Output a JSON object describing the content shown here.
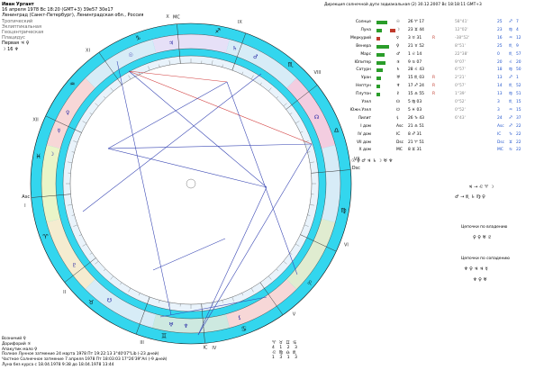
{
  "header": {
    "name": "Иван Ургант",
    "datetime": "16 апреля 1978  Вс  18:20 (GMT+3) 39е57  30е17",
    "place": "Ленинград (Санкт-Петербург), Ленинградская обл., Россия",
    "systems": [
      "Тропический",
      "Эклиптикальная",
      "Геоцентрическая",
      "Плацидус"
    ],
    "rank_label": "Первая",
    "rank_symbols": "♃  ♀",
    "rank_line2": "☽  16  ♆"
  },
  "progression_title": "Дирекция солнечной дуги зодиакальная (2) 30.12.2007  Вс 18:18:11 GMT+3",
  "table_headers": [
    "",
    "",
    " ",
    "R",
    "E",
    "D",
    "F",
    "Ω",
    "V"
  ],
  "planets": [
    {
      "name": "Солнце",
      "glyph": "☉",
      "pos": "26 ♈ 17",
      "retro": "",
      "dign": "",
      "lat": "58°41'",
      "bar": "#2a9d2a",
      "bar_w": 24,
      "col2": "",
      "house": "25",
      "house_sign": "♐",
      "hn": "7"
    },
    {
      "name": "Луна",
      "glyph": "☽",
      "pos": "23 ♊ 44",
      "retro": "",
      "dign": "",
      "lat": "12°02'",
      "bar": "#2a9d2a",
      "bar_w": 12,
      "col2": "#c0392b",
      "house": "23",
      "house_sign": "♍",
      "hn": "4"
    },
    {
      "name": "Меркурий",
      "glyph": "☿",
      "pos": "3 ♉ 31",
      "retro": "R",
      "dign": "",
      "lat": "-38°52'",
      "bar": "#c0392b",
      "bar_w": 8,
      "col2": "",
      "house": "16",
      "house_sign": "♒",
      "hn": "12"
    },
    {
      "name": "Венера",
      "glyph": "♀",
      "pos": "21 ♉ 52",
      "retro": "",
      "dign": "",
      "lat": "8°51'",
      "bar": "#2a9d2a",
      "bar_w": 28,
      "col2": "",
      "house": "25",
      "house_sign": "♏",
      "hn": "9"
    },
    {
      "name": "Марс",
      "glyph": "♂",
      "pos": "1 ♌ 14",
      "retro": "",
      "dign": "",
      "lat": "22°38'",
      "bar": "#2a9d2a",
      "bar_w": 18,
      "col2": "",
      "house": "0",
      "house_sign": "♏",
      "hn": "57"
    },
    {
      "name": "Юпитер",
      "glyph": "♃",
      "pos": "9 ♋ 07",
      "retro": "",
      "dign": "",
      "lat": "9°07'",
      "bar": "#2a9d2a",
      "bar_w": 20,
      "col2": "",
      "house": "20",
      "house_sign": "♌",
      "hn": "20"
    },
    {
      "name": "Сатурн",
      "glyph": "♄",
      "pos": "28 ♌ 43",
      "retro": "",
      "dign": "",
      "lat": "6°57'",
      "bar": "#2a9d2a",
      "bar_w": 14,
      "col2": "",
      "house": "18",
      "house_sign": "♍",
      "hn": "50"
    },
    {
      "name": "Уран",
      "glyph": "♅",
      "pos": "15 ♏ 03",
      "retro": "R",
      "dign": "",
      "lat": "2°21'",
      "bar": "#2a9d2a",
      "bar_w": 10,
      "col2": "",
      "house": "13",
      "house_sign": "♐",
      "hn": "1"
    },
    {
      "name": "Нептун",
      "glyph": "♆",
      "pos": "17 ♐ 24",
      "retro": "R",
      "dign": "",
      "lat": "0°57'",
      "bar": "#2a9d2a",
      "bar_w": 8,
      "col2": "",
      "house": "14",
      "house_sign": "♏",
      "hn": "52"
    },
    {
      "name": "Плутон",
      "glyph": "♇",
      "pos": "15 ♎ 55",
      "retro": "R",
      "dign": "",
      "lat": "1°39'",
      "bar": "#2a9d2a",
      "bar_w": 8,
      "col2": "",
      "house": "13",
      "house_sign": "♍",
      "hn": "51"
    },
    {
      "name": "Узел",
      "glyph": "☊",
      "pos": "5 ♍ 03",
      "retro": "",
      "dign": "",
      "lat": "0°52'",
      "bar": "",
      "bar_w": 0,
      "col2": "",
      "house": "3",
      "house_sign": "♏",
      "hn": "15"
    },
    {
      "name": "Южн.Узел",
      "glyph": "☋",
      "pos": "5 ♓ 03",
      "retro": "",
      "dign": "",
      "lat": "0°52'",
      "bar": "",
      "bar_w": 0,
      "col2": "",
      "house": "3",
      "house_sign": "♒",
      "hn": "15"
    },
    {
      "name": "Лилит",
      "glyph": "⚸",
      "pos": "26 ♑ 43",
      "retro": "",
      "dign": "",
      "lat": "6°43'",
      "bar": "",
      "bar_w": 0,
      "col2": "",
      "house": "24",
      "house_sign": "♐",
      "hn": "37"
    }
  ],
  "houses": [
    {
      "name": "I дом",
      "glyph": "Asc",
      "pos": "21 ♎ 51",
      "house": "Asc",
      "house_sign": "♐",
      "hn": "22"
    },
    {
      "name": "IV дом",
      "glyph": "IC",
      "pos": "8 ♐ 31",
      "house": "IC",
      "house_sign": "♑",
      "hn": "22"
    },
    {
      "name": "VII дом",
      "glyph": "Dsc",
      "pos": "21 ♈ 51",
      "house": "Dsc",
      "house_sign": "♊",
      "hn": "22"
    },
    {
      "name": "X дом",
      "glyph": "MC",
      "pos": "8 ♊ 31",
      "house": "MC",
      "house_sign": "♋",
      "hn": "22"
    }
  ],
  "aspect_row": "☉  ♀  ♂  ♃  ♄  ☽  ♅  ♆",
  "chains": {
    "title1": "Цепочки по владению",
    "title2": "Цепочки по сопадению",
    "c1": "♃ → ♌ ♈ ☽",
    "c2": "♂ → ♏ ♄ ♍ ♀",
    "c3": "♀ ♀ ♅ ♇",
    "c4": "♆ ♀ ♃ ♃ ☿",
    "c5": "♆ ♀ ♅"
  },
  "footer": {
    "l1": "Возничий  ♀",
    "l2": "Дорифорий  ♃",
    "l3": "Апакутик  мало  ♀",
    "l4": "Полное Лунное затмение 24 марта 1978 Пт 19:22:13  3°40'07\"Lib (-23 дней)",
    "l5": "Частное Солнечное затмение 7 апреля 1978 Пт 18:03:03 17°26'39\"Ari (-9 дней)",
    "l6": "Луна без курса с 18.04.1978  9:38  до 18.04.1978 13:44"
  },
  "bottom_legend": {
    "row1": [
      "♈",
      "♉",
      "♊",
      "♋"
    ],
    "row1_vals": [
      "4",
      "1",
      "2",
      "3"
    ],
    "row2": [
      "♌",
      "♍",
      "♎",
      "♏"
    ],
    "row2_vals": [
      "1",
      "3",
      "1",
      "3"
    ]
  },
  "wheel": {
    "zodiac_signs": [
      "♈",
      "♉",
      "♊",
      "♋",
      "♌",
      "♍",
      "♎",
      "♏",
      "♐",
      "♑",
      "♒",
      "♓"
    ],
    "house_labels": [
      "I",
      "II",
      "III",
      "IV",
      "V",
      "VI",
      "VII",
      "VIII",
      "IX",
      "X",
      "XI",
      "XII"
    ],
    "asc": "Asc",
    "mc": "MC",
    "ic": "IC",
    "dsc": "Dsc"
  }
}
